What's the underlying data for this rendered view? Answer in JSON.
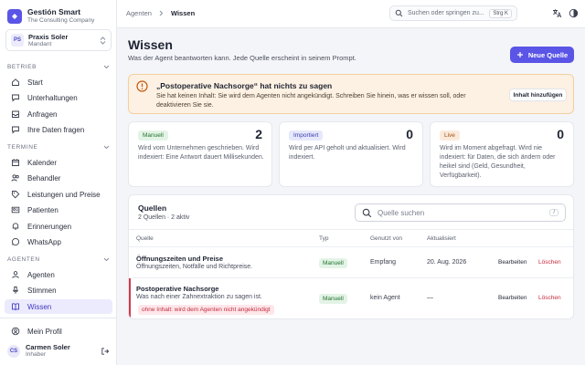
{
  "brand": {
    "name": "Gestión Smart",
    "subtitle": "The Consulting Company"
  },
  "practice": {
    "initials": "PS",
    "name": "Praxis Soler",
    "role": "Mandant"
  },
  "sidebar": {
    "sections": [
      {
        "label": "BETRIEB",
        "items": [
          "Start",
          "Unterhaltungen",
          "Anfragen",
          "Ihre Daten fragen"
        ]
      },
      {
        "label": "TERMINE",
        "items": [
          "Kalender",
          "Behandler",
          "Leistungen und Preise",
          "Patienten",
          "Erinnerungen",
          "WhatsApp"
        ]
      },
      {
        "label": "AGENTEN",
        "items": [
          "Agenten",
          "Stimmen",
          "Wissen"
        ]
      }
    ],
    "profile_label": "Mein Profil"
  },
  "user": {
    "initials": "CS",
    "name": "Carmen Soler",
    "role": "Inhaber"
  },
  "topbar": {
    "breadcrumb": [
      "Agenten",
      "Wissen"
    ],
    "search_placeholder": "Suchen oder springen zu...",
    "shortcut": "Strg K"
  },
  "page": {
    "title": "Wissen",
    "subtitle": "Was der Agent beantworten kann. Jede Quelle erscheint in seinem Prompt.",
    "new_button": "Neue Quelle"
  },
  "alert": {
    "title": "„Postoperative Nachsorge“ hat nichts zu sagen",
    "text": "Sie hat keinen Inhalt: Sie wird dem Agenten nicht angekündigt. Schreiben Sie hinein, was er wissen soll, oder deaktivieren Sie sie.",
    "button": "Inhalt hinzufügen"
  },
  "cards": [
    {
      "badge": "Manuell",
      "count": "2",
      "text": "Wird vom Unternehmen geschrieben. Wird indexiert: Eine Antwort dauert Millisekunden."
    },
    {
      "badge": "Importiert",
      "count": "0",
      "text": "Wird per API geholt und aktualisiert. Wird indexiert."
    },
    {
      "badge": "Live",
      "count": "0",
      "text": "Wird im Moment abgefragt. Wird nie indexiert: für Daten, die sich ändern oder heikel sind (Geld, Gesundheit, Verfügbarkeit)."
    }
  ],
  "sources": {
    "title": "Quellen",
    "summary": "2 Quellen · 2 aktiv",
    "search_placeholder": "Quelle suchen",
    "search_key": "/",
    "columns": [
      "Quelle",
      "Typ",
      "Genutzt von",
      "Aktualisiert"
    ],
    "rows": [
      {
        "name": "Öffnungszeiten und Preise",
        "desc": "Öffnungszeiten, Notfälle und Richtpreise.",
        "type": "Manuell",
        "used_by": "Empfang",
        "updated": "20. Aug. 2026",
        "edit": "Bearbeiten",
        "delete": "Löschen",
        "warning": ""
      },
      {
        "name": "Postoperative Nachsorge",
        "desc": "Was nach einer Zahnextraktion zu sagen ist.",
        "type": "Manuell",
        "used_by": "kein Agent",
        "updated": "—",
        "edit": "Bearbeiten",
        "delete": "Löschen",
        "warning": "ohne Inhalt: wird dem Agenten nicht angekündigt"
      }
    ]
  },
  "colors": {
    "accent": "#5a55e6",
    "warning_bg": "#fdf1e3",
    "danger": "#c42c3e",
    "success": "#23722f"
  }
}
